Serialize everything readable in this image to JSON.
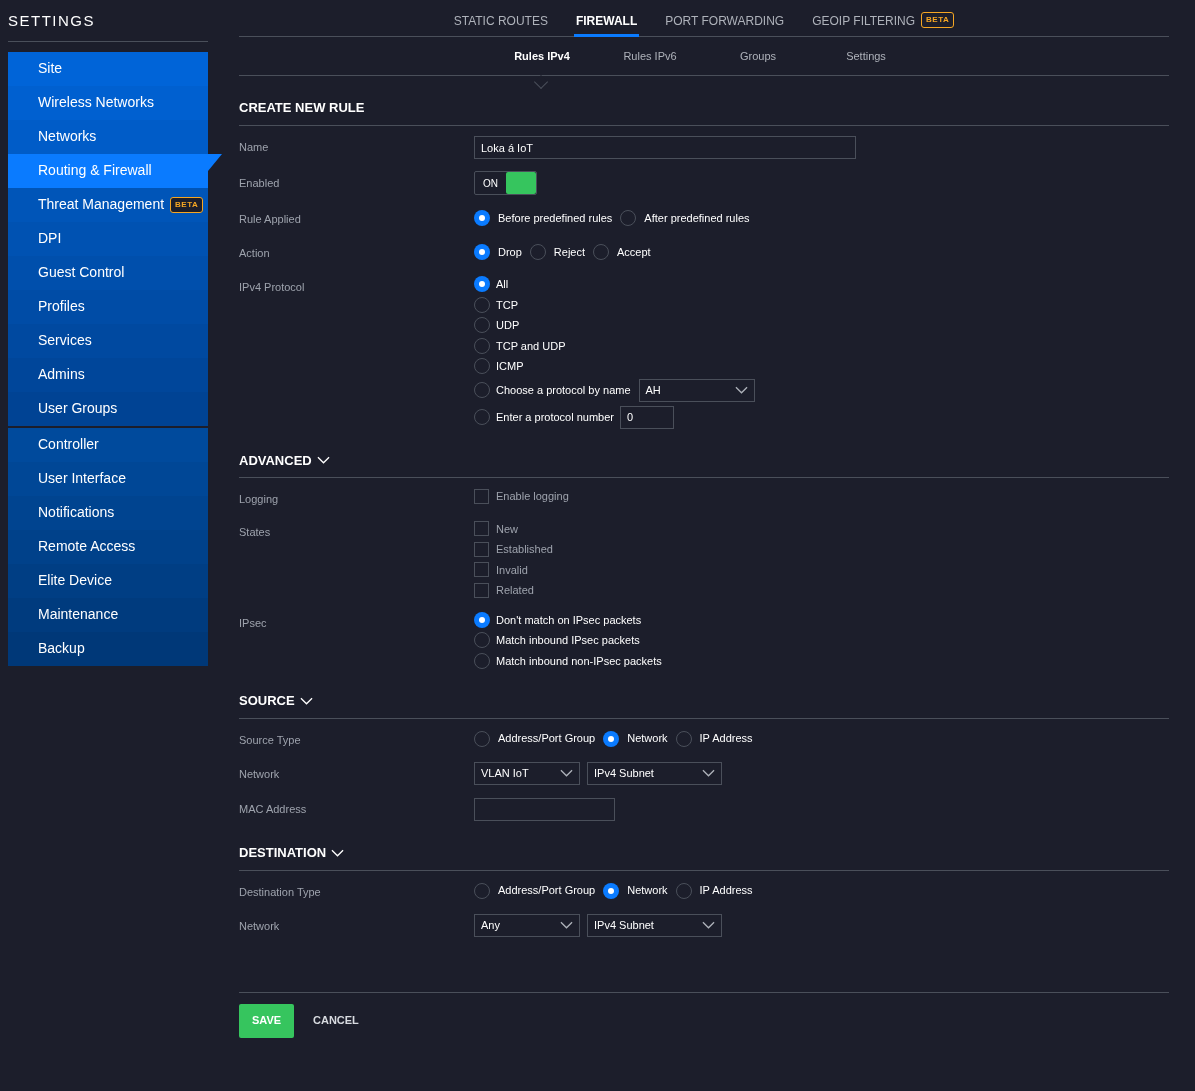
{
  "sidebar": {
    "title": "SETTINGS",
    "groups": [
      [
        {
          "label": "Site",
          "selected": false
        },
        {
          "label": "Wireless Networks",
          "selected": false
        },
        {
          "label": "Networks",
          "selected": false
        },
        {
          "label": "Routing & Firewall",
          "selected": true
        },
        {
          "label": "Threat Management",
          "selected": false,
          "badge": "BETA"
        },
        {
          "label": "DPI",
          "selected": false
        },
        {
          "label": "Guest Control",
          "selected": false
        },
        {
          "label": "Profiles",
          "selected": false
        },
        {
          "label": "Services",
          "selected": false
        },
        {
          "label": "Admins",
          "selected": false
        },
        {
          "label": "User Groups",
          "selected": false
        }
      ],
      [
        {
          "label": "Controller",
          "selected": false
        },
        {
          "label": "User Interface",
          "selected": false
        },
        {
          "label": "Notifications",
          "selected": false
        },
        {
          "label": "Remote Access",
          "selected": false
        },
        {
          "label": "Elite Device",
          "selected": false
        },
        {
          "label": "Maintenance",
          "selected": false
        },
        {
          "label": "Backup",
          "selected": false
        }
      ]
    ]
  },
  "tabs": [
    {
      "label": "STATIC ROUTES",
      "selected": false
    },
    {
      "label": "FIREWALL",
      "selected": true
    },
    {
      "label": "PORT FORWARDING",
      "selected": false
    },
    {
      "label": "GEOIP FILTERING",
      "selected": false,
      "badge": "BETA"
    }
  ],
  "subtabs": [
    {
      "label": "Rules IPv4",
      "selected": true
    },
    {
      "label": "Rules IPv6",
      "selected": false
    },
    {
      "label": "Groups",
      "selected": false
    },
    {
      "label": "Settings",
      "selected": false
    }
  ],
  "sections": [
    {
      "title": "CREATE NEW RULE",
      "fields": [
        {
          "label": "Name",
          "kind": "text",
          "value": "Loka á IoT"
        },
        {
          "label": "Enabled",
          "kind": "toggle",
          "on": true,
          "text": "ON"
        },
        {
          "label": "Rule Applied",
          "kind": "radio-inline",
          "options": [
            {
              "label": "Before predefined rules",
              "selected": true
            },
            {
              "label": "After predefined rules",
              "selected": false
            }
          ]
        },
        {
          "label": "Action",
          "kind": "radio-inline",
          "options": [
            {
              "label": "Drop",
              "selected": true
            },
            {
              "label": "Reject",
              "selected": false
            },
            {
              "label": "Accept",
              "selected": false
            }
          ]
        },
        {
          "label": "IPv4 Protocol",
          "kind": "radio-list",
          "options": [
            {
              "label": "All",
              "selected": true
            },
            {
              "label": "TCP",
              "selected": false
            },
            {
              "label": "UDP",
              "selected": false
            },
            {
              "label": "TCP and UDP",
              "selected": false
            },
            {
              "label": "ICMP",
              "selected": false
            },
            {
              "label": "Choose a protocol by name",
              "selected": false,
              "select": "AH"
            },
            {
              "label": "Enter a protocol number",
              "selected": false,
              "input": "0"
            }
          ]
        }
      ]
    },
    {
      "title": "ADVANCED",
      "expanded": true,
      "fields": [
        {
          "label": "Logging",
          "kind": "checkbox-list",
          "options": [
            {
              "label": "Enable logging",
              "checked": false
            }
          ]
        },
        {
          "label": "States",
          "kind": "checkbox-list",
          "options": [
            {
              "label": "New",
              "checked": false
            },
            {
              "label": "Established",
              "checked": false
            },
            {
              "label": "Invalid",
              "checked": false
            },
            {
              "label": "Related",
              "checked": false
            }
          ]
        },
        {
          "label": "IPsec",
          "kind": "radio-list",
          "options": [
            {
              "label": "Don't match on IPsec packets",
              "selected": true
            },
            {
              "label": "Match inbound IPsec packets",
              "selected": false
            },
            {
              "label": "Match inbound non-IPsec packets",
              "selected": false
            }
          ]
        }
      ]
    },
    {
      "title": "SOURCE",
      "expanded": true,
      "fields": [
        {
          "label": "Source Type",
          "kind": "radio-inline",
          "options": [
            {
              "label": "Address/Port Group",
              "selected": false
            },
            {
              "label": "Network",
              "selected": true
            },
            {
              "label": "IP Address",
              "selected": false
            }
          ]
        },
        {
          "label": "Network",
          "kind": "selects",
          "selects": [
            "VLAN IoT",
            "IPv4 Subnet"
          ]
        },
        {
          "label": "MAC Address",
          "kind": "text"
        }
      ]
    },
    {
      "title": "DESTINATION",
      "expanded": true,
      "fields": [
        {
          "label": "Destination Type",
          "kind": "radio-inline",
          "options": [
            {
              "label": "Address/Port Group",
              "selected": false
            },
            {
              "label": "Network",
              "selected": true
            },
            {
              "label": "IP Address",
              "selected": false
            }
          ]
        },
        {
          "label": "Network",
          "kind": "selects",
          "selects": [
            "Any",
            "IPv4 Subnet"
          ]
        }
      ]
    }
  ],
  "buttons": {
    "save": "SAVE",
    "cancel": "CANCEL"
  }
}
